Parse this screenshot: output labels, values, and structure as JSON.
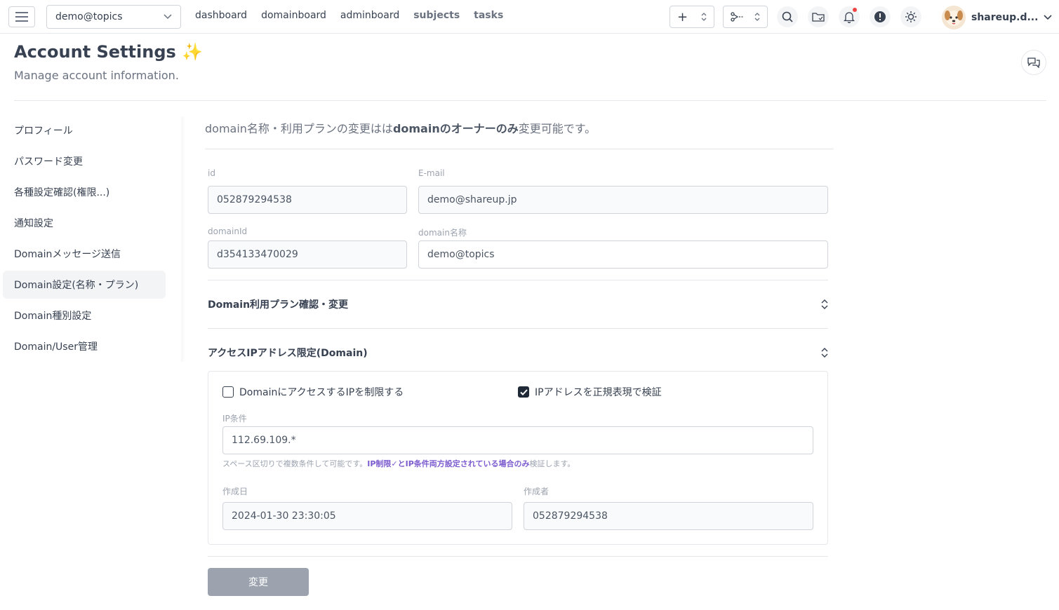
{
  "navbar": {
    "domain_select": "demo@topics",
    "links": [
      "dashboard",
      "domainboard",
      "adminboard",
      "subjects",
      "tasks"
    ],
    "stepper1_icon": "+",
    "stepper2_icon": "scissors-icon",
    "username": "shareup.d..."
  },
  "header": {
    "title": "Account Settings ✨",
    "subtitle": "Manage account information."
  },
  "sidebar": {
    "items": [
      {
        "label": "プロフィール"
      },
      {
        "label": "パスワード変更"
      },
      {
        "label": "各種設定確認(権限...)"
      },
      {
        "label": "通知設定"
      },
      {
        "label": "Domainメッセージ送信"
      },
      {
        "label": "Domain設定(名称・プラン)"
      },
      {
        "label": "Domain種別設定"
      },
      {
        "label": "Domain/User管理"
      }
    ],
    "active_index": 5
  },
  "notice": {
    "pre": "domain名称・利用プランの変更はは",
    "bold": "domainのオーナーのみ",
    "post": "変更可能です。"
  },
  "fields": {
    "id_label": "id",
    "id_value": "052879294538",
    "email_label": "E-mail",
    "email_value": "demo@shareup.jp",
    "domainid_label": "domainId",
    "domainid_value": "d354133470029",
    "domainname_label": "domain名称",
    "domainname_value": "demo@topics"
  },
  "sections": {
    "plan_title": "Domain利用プラン確認・変更",
    "ip_title": "アクセスIPアドレス限定(Domain)"
  },
  "ip": {
    "restrict_label": "DomainにアクセスするIPを制限する",
    "restrict_checked": false,
    "regex_label": "IPアドレスを正規表現で検証",
    "regex_checked": true,
    "condition_label": "IP条件",
    "condition_value": "112.69.109.*",
    "hint_pre": "スペース区切りで複数条件して可能です。",
    "hint_highlight": "IP制限✓とIP条件両方設定されている場合のみ",
    "hint_post": "検証します。",
    "created_label": "作成日",
    "created_value": "2024-01-30 23:30:05",
    "creator_label": "作成者",
    "creator_value": "052879294538"
  },
  "submit_label": "変更"
}
